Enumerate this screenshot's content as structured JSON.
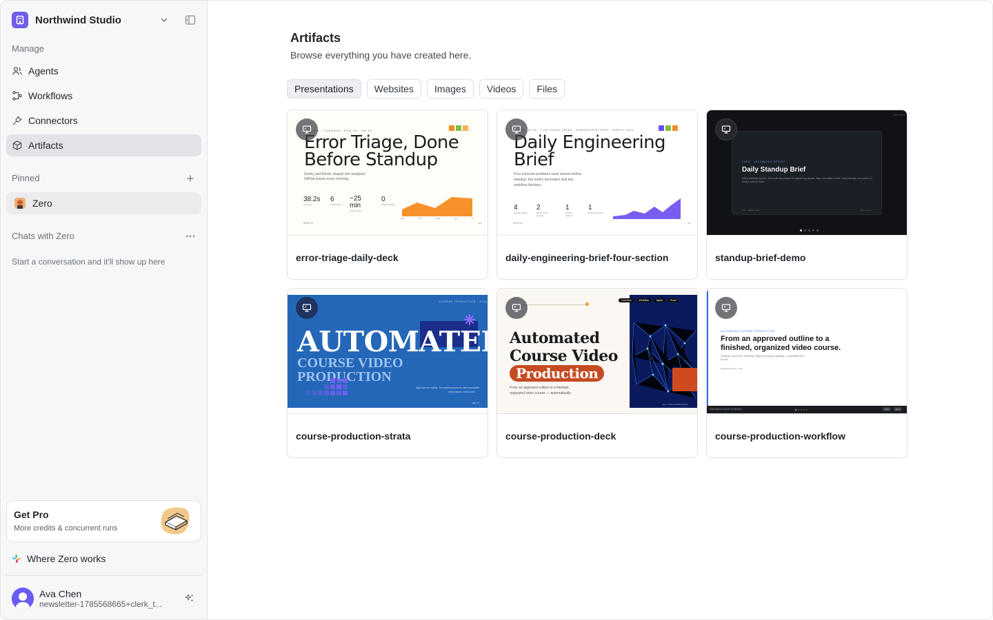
{
  "workspace": {
    "name": "Northwind Studio"
  },
  "sidebar": {
    "manage_label": "Manage",
    "nav": [
      {
        "label": "Agents",
        "icon": "users-icon"
      },
      {
        "label": "Workflows",
        "icon": "workflow-icon"
      },
      {
        "label": "Connectors",
        "icon": "plug-icon"
      },
      {
        "label": "Artifacts",
        "icon": "cube-icon",
        "active": true
      }
    ],
    "pinned_label": "Pinned",
    "pinned": [
      {
        "label": "Zero"
      }
    ],
    "chats_label": "Chats with Zero",
    "chats_empty": "Start a conversation and it'll show up here",
    "pro": {
      "title": "Get Pro",
      "subtitle": "More credits & concurrent runs"
    },
    "where": "Where Zero works",
    "user": {
      "name": "Ava Chen",
      "email": "newsletter-1785568665+clerk_t..."
    }
  },
  "main": {
    "title": "Artifacts",
    "subtitle": "Browse everything you have created here.",
    "tabs": [
      {
        "label": "Presentations",
        "active": true
      },
      {
        "label": "Websites"
      },
      {
        "label": "Images"
      },
      {
        "label": "Videos"
      },
      {
        "label": "Files"
      }
    ],
    "artifacts": [
      {
        "name": "error-triage-daily-deck",
        "thumb": {
          "kicker": "DAWN · TUESDAY, APR 28 · 08:40",
          "title_line1": "Error Triage, Done",
          "title_line2": "Before Standup",
          "body_line1": "Sentry and Axiom, triaged into assigned",
          "body_line2": "GitHub issues every morning.",
          "stats": [
            {
              "value": "38.2s",
              "label": "Run time"
            },
            {
              "value": "6",
              "label": "Issues filed"
            },
            {
              "value": "~25 min",
              "label": "Triage saved"
            },
            {
              "value": "0",
              "label": "Paged missed"
            }
          ],
          "x_labels": [
            "Mon",
            "Tue",
            "Wed",
            "Thu",
            "Fri"
          ],
          "footer_left": "ZERO AI",
          "footer_right": "1/4"
        }
      },
      {
        "name": "daily-engineering-brief-four-section",
        "thumb": {
          "kicker": "2026 · 04-28 · 7-DAY VISUAL TREND · GENERATED BY ZERO · SAMPLE DATA",
          "title_line1": "Daily Engineering",
          "title_line2": "Brief",
          "body_line1": "Four concrete problems need owners before",
          "body_line2": "standup: two metric anomalies and two",
          "body_line3": "workflow blockers.",
          "stats": [
            {
              "value": "4",
              "label": "Specific issues"
            },
            {
              "value": "2",
              "label": "above 7-day average"
            },
            {
              "value": "1",
              "label": "Review blocked"
            },
            {
              "value": "1",
              "label": "Delivery blocked"
            }
          ],
          "footer_left": "ZERO AI",
          "footer_right": "1/4"
        }
      },
      {
        "name": "standup-brief-demo",
        "thumb": {
          "kicker": "ZERO · AUTOMATED REPORT",
          "title": "Daily Standup Brief",
          "body": "Every weekday at 8:30, Zero pulls the product & engineering signals, flags anomalies vs the 7-day average, and posts a 4-section brief to Slack.",
          "footer_left": "Zero · sample data",
          "footer_right": "Mon, Jun 2",
          "corner": "ZERO BRIEF"
        }
      },
      {
        "name": "course-production-strata",
        "thumb": {
          "top": "COURSE PRODUCTION · 2026",
          "title": "AUTOMATED",
          "sub_line1": "COURSE VIDEO",
          "sub_line2": "PRODUCTION",
          "body_line1": "Approved an outline. The system produces, files and audits",
          "body_line2": "every lesson, end to end.",
          "footer": "Apr 17"
        }
      },
      {
        "name": "course-production-deck",
        "thumb": {
          "title_line1": "Automated",
          "title_line2": "Course Video",
          "pill": "Production",
          "body_line1": "From an approved outline to a finished,",
          "body_line2": "organized video course — automatically.",
          "nav": [
            "Overview",
            "Workflow",
            "Agent",
            "Proof"
          ],
          "caption": "Zero · course production pipeline"
        }
      },
      {
        "name": "course-production-workflow",
        "thumb": {
          "kicker": "AUTOMATED COURSE PRODUCTION",
          "title_line1": "From an approved outline to a",
          "title_line2": "finished, organized video course.",
          "body_line1": "Scripting, voice-over, rendering, filing and progress tracking — automated end",
          "body_line2": "to end.",
          "prepared": "Prepared by Zero · web",
          "footer_left": "Automated Course Production",
          "footer_right_1": "Prev",
          "footer_right_2": "Next"
        }
      }
    ]
  }
}
